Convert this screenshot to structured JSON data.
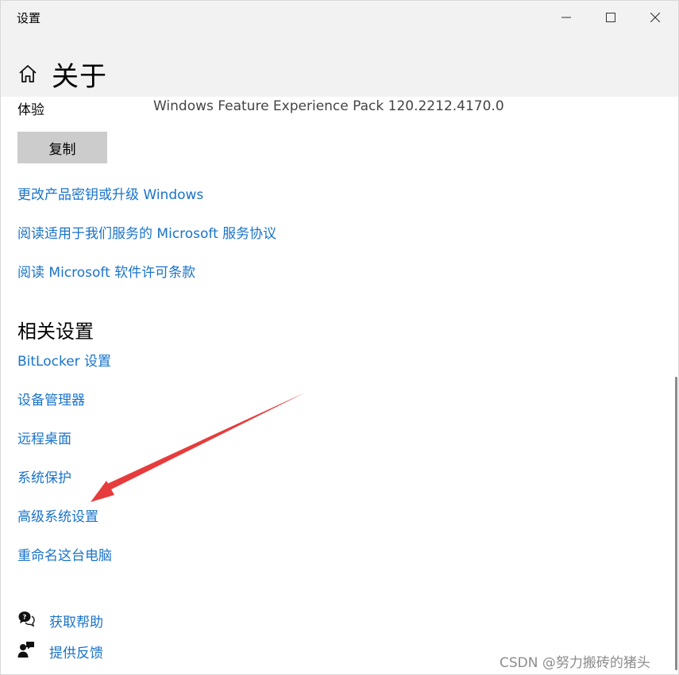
{
  "window": {
    "title": "设置"
  },
  "header": {
    "page_title": "关于"
  },
  "experience_row": {
    "label": "体验",
    "value": "Windows Feature Experience Pack 120.2212.4170.0"
  },
  "copy_label": "复制",
  "links": [
    {
      "label": "更改产品密钥或升级 Windows"
    },
    {
      "label": "阅读适用于我们服务的 Microsoft 服务协议"
    },
    {
      "label": "阅读 Microsoft 软件许可条款"
    }
  ],
  "related_settings": {
    "heading": "相关设置",
    "items": [
      {
        "label": "BitLocker 设置"
      },
      {
        "label": "设备管理器"
      },
      {
        "label": "远程桌面"
      },
      {
        "label": "系统保护"
      },
      {
        "label": "高级系统设置"
      },
      {
        "label": "重命名这台电脑"
      }
    ]
  },
  "help": {
    "get_help": "获取帮助",
    "feedback": "提供反馈"
  },
  "watermark": "CSDN @努力搬砖的猪头",
  "colors": {
    "link": "#1a73c9",
    "titlebar": "#f2f2f2",
    "button": "#cccccc",
    "annotation_arrow": "#e63c3c"
  }
}
